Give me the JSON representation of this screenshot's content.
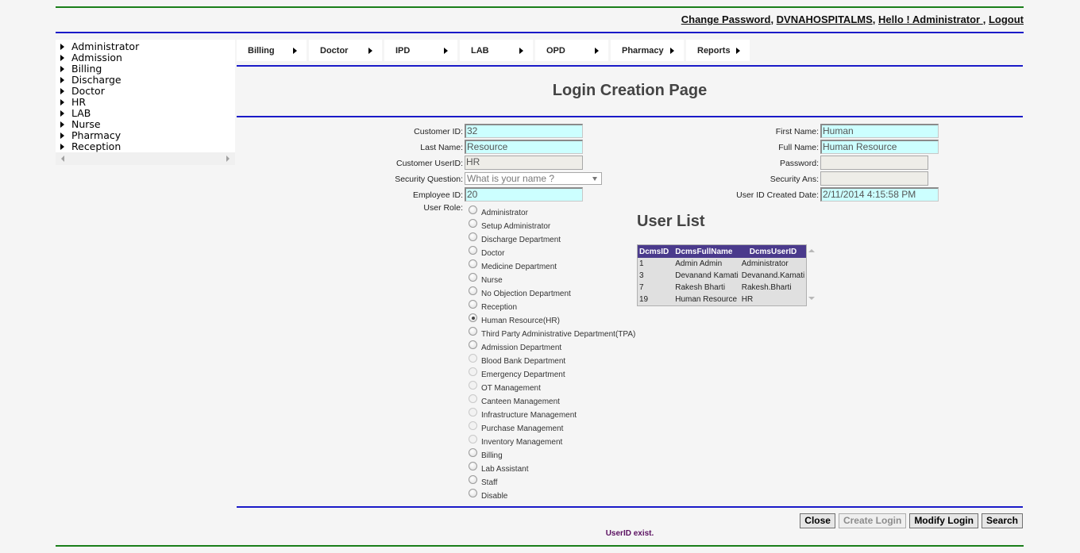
{
  "header": {
    "links": [
      "Change Password",
      "DVNAHOSPITALMS",
      "Hello ! Administrator ",
      "Logout"
    ],
    "separators": [
      ", ",
      ", ",
      ", "
    ]
  },
  "sidebar": {
    "items": [
      "Administrator",
      "Admission",
      "Billing",
      "Discharge",
      "Doctor",
      "HR",
      "LAB",
      "Nurse",
      "Pharmacy",
      "Reception"
    ]
  },
  "menu": {
    "items": [
      "Billing",
      "Doctor",
      "IPD",
      "LAB",
      "OPD",
      "Pharmacy",
      "Reports"
    ]
  },
  "page": {
    "title": "Login Creation Page"
  },
  "form": {
    "customer_id": {
      "label": "Customer ID:",
      "value": "32"
    },
    "last_name": {
      "label": "Last Name:",
      "value": "Resource"
    },
    "customer_userid": {
      "label": "Customer UserID:",
      "value": "HR"
    },
    "security_question": {
      "label": "Security Question:",
      "value": "What is your name ?"
    },
    "employee_id": {
      "label": "Employee ID:",
      "value": "20"
    },
    "first_name": {
      "label": "First Name:",
      "value": "Human"
    },
    "full_name": {
      "label": "Full Name:",
      "value": "Human Resource"
    },
    "password": {
      "label": "Password:",
      "value": ""
    },
    "security_ans": {
      "label": "Security Ans:",
      "value": ""
    },
    "created_date": {
      "label": "User ID Created Date:",
      "value": "2/11/2014 4:15:58 PM"
    },
    "user_role": {
      "label": "User Role:",
      "selected": "Human Resource(HR)",
      "options": [
        {
          "label": "Administrator",
          "disabled": false
        },
        {
          "label": "Setup Administrator",
          "disabled": false
        },
        {
          "label": "Discharge Department",
          "disabled": false
        },
        {
          "label": "Doctor",
          "disabled": false
        },
        {
          "label": "Medicine Department",
          "disabled": false
        },
        {
          "label": "Nurse",
          "disabled": false
        },
        {
          "label": "No Objection Department",
          "disabled": false
        },
        {
          "label": "Reception",
          "disabled": false
        },
        {
          "label": "Human Resource(HR)",
          "disabled": false
        },
        {
          "label": "Third Party Administrative Department(TPA)",
          "disabled": false
        },
        {
          "label": "Admission Department",
          "disabled": false
        },
        {
          "label": "Blood Bank Department",
          "disabled": true
        },
        {
          "label": "Emergency Department",
          "disabled": true
        },
        {
          "label": "OT Management",
          "disabled": true
        },
        {
          "label": "Canteen Management",
          "disabled": true
        },
        {
          "label": "Infrastructure Management",
          "disabled": true
        },
        {
          "label": "Purchase Management",
          "disabled": true
        },
        {
          "label": "Inventory Management",
          "disabled": true
        },
        {
          "label": "Billing",
          "disabled": false
        },
        {
          "label": "Lab Assistant",
          "disabled": false
        },
        {
          "label": "Staff",
          "disabled": false
        },
        {
          "label": "Disable",
          "disabled": false
        }
      ]
    }
  },
  "user_list": {
    "title": "User List",
    "columns": [
      "DcmsID",
      "DcmsFullName",
      "DcmsUserID"
    ],
    "rows": [
      [
        "1",
        "Admin Admin",
        "Administrator"
      ],
      [
        "3",
        "Devanand Kamati",
        "Devanand.Kamati"
      ],
      [
        "7",
        "Rakesh Bharti",
        "Rakesh.Bharti"
      ],
      [
        "19",
        "Human Resource",
        "HR"
      ]
    ]
  },
  "buttons": {
    "close": "Close",
    "create_login": "Create Login",
    "modify_login": "Modify Login",
    "search": "Search"
  },
  "status": {
    "message": "UserID exist."
  }
}
